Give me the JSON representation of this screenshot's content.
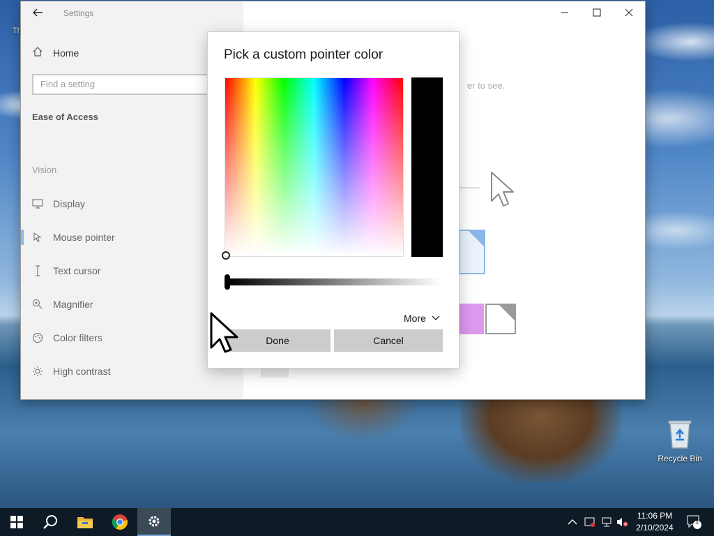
{
  "desktop": {
    "recycle_bin_label": "Recycle Bin",
    "left_edge_label": "Th"
  },
  "settings_window": {
    "title": "Settings",
    "home_label": "Home",
    "search_placeholder": "Find a setting",
    "section_title": "Ease of Access",
    "group_label": "Vision",
    "nav_items": [
      {
        "label": "Display",
        "icon": "display-icon"
      },
      {
        "label": "Mouse pointer",
        "icon": "mouse-pointer-icon"
      },
      {
        "label": "Text cursor",
        "icon": "text-cursor-icon"
      },
      {
        "label": "Magnifier",
        "icon": "magnifier-icon"
      },
      {
        "label": "Color filters",
        "icon": "color-filters-icon"
      },
      {
        "label": "High contrast",
        "icon": "high-contrast-icon"
      }
    ],
    "active_nav": "Mouse pointer",
    "main_hint_fragment": "er to see.",
    "colors": {
      "accent": "#8ab8e6",
      "custom_swatch": "#dd99ee"
    }
  },
  "dialog": {
    "title": "Pick a custom pointer color",
    "more_label": "More",
    "done_label": "Done",
    "cancel_label": "Cancel",
    "selected_color": "#000000",
    "value_level": 0
  },
  "taskbar": {
    "time": "11:06 PM",
    "date": "2/10/2024",
    "notification_count": "1",
    "pinned": [
      "start-icon",
      "search-icon",
      "file-explorer-icon",
      "chrome-icon",
      "settings-icon"
    ],
    "active": "settings-icon"
  }
}
